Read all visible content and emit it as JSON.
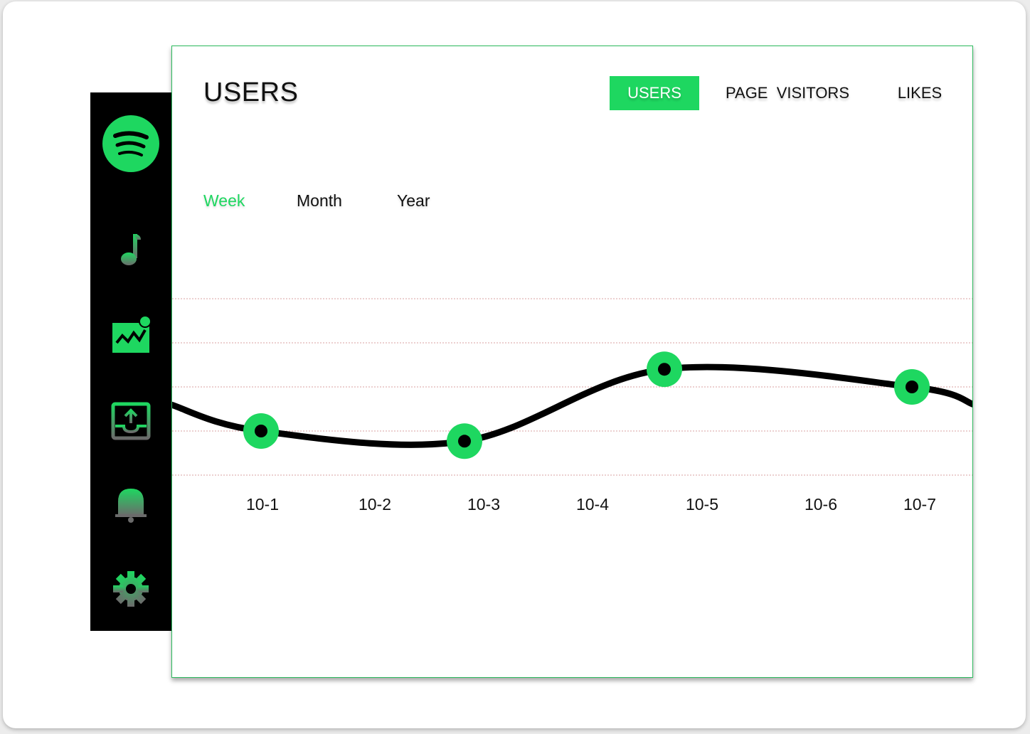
{
  "sidebar": {
    "items": [
      {
        "icon": "spotify-logo-icon"
      },
      {
        "icon": "music-note-icon"
      },
      {
        "icon": "analytics-chart-icon"
      },
      {
        "icon": "upload-tray-icon"
      },
      {
        "icon": "bell-icon"
      },
      {
        "icon": "gear-icon"
      }
    ]
  },
  "header": {
    "title": "USERS",
    "tabs": [
      {
        "label": "USERS",
        "active": true
      },
      {
        "label": "PAGE  VISITORS",
        "active": false
      },
      {
        "label": "LIKES",
        "active": false
      }
    ]
  },
  "periods": [
    {
      "label": "Week",
      "active": true
    },
    {
      "label": "Month",
      "active": false
    },
    {
      "label": "Year",
      "active": false
    }
  ],
  "colors": {
    "accent": "#1ed760",
    "sidebar_bg": "#000000",
    "line": "#000000",
    "grid": "#d9a0a0"
  },
  "chart_data": {
    "type": "line",
    "categories": [
      "10-1",
      "10-2",
      "10-3",
      "10-4",
      "10-5",
      "10-6",
      "10-7"
    ],
    "grid": true,
    "gridlines": 5,
    "ylim": [
      0,
      4
    ],
    "markers": [
      {
        "x": "10-1",
        "y": 1.0
      },
      {
        "x": "10-3",
        "y": 0.77
      },
      {
        "x": "10-5",
        "y": 2.4
      },
      {
        "x": "10-7",
        "y": 2.0
      }
    ]
  }
}
